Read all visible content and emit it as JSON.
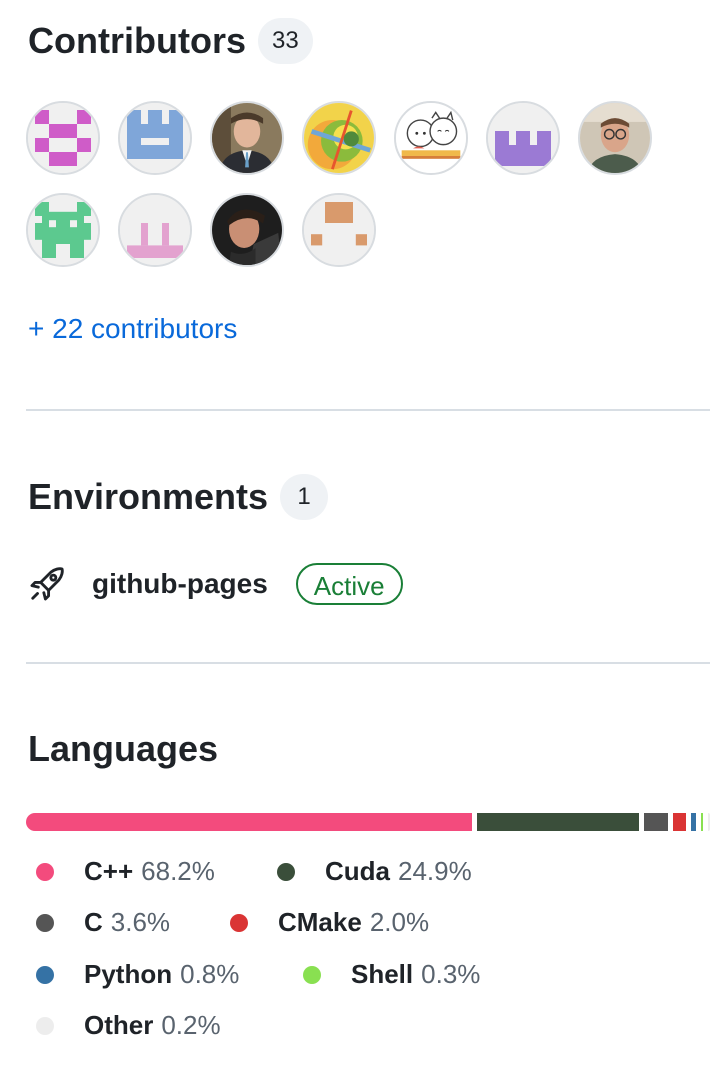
{
  "contributors": {
    "title": "Contributors",
    "count": "33",
    "more_link": "+ 22 contributors",
    "avatars": [
      {
        "name": "avatar-pink-identicon"
      },
      {
        "name": "avatar-blue-identicon"
      },
      {
        "name": "avatar-photo-man-suit"
      },
      {
        "name": "avatar-colorful-abstract"
      },
      {
        "name": "avatar-cartoon-animals"
      },
      {
        "name": "avatar-purple-identicon"
      },
      {
        "name": "avatar-photo-man-glasses"
      },
      {
        "name": "avatar-green-identicon"
      },
      {
        "name": "avatar-pink-light-identicon"
      },
      {
        "name": "avatar-photo-man-dark"
      },
      {
        "name": "avatar-orange-identicon"
      }
    ]
  },
  "environments": {
    "title": "Environments",
    "count": "1",
    "items": [
      {
        "name": "github-pages",
        "status": "Active",
        "icon": "rocket-icon"
      }
    ]
  },
  "languages": {
    "title": "Languages",
    "items": [
      {
        "name": "C++",
        "percent": "68.2%",
        "value": 68.2,
        "color": "#f34b7d"
      },
      {
        "name": "Cuda",
        "percent": "24.9%",
        "value": 24.9,
        "color": "#3a4e3a"
      },
      {
        "name": "C",
        "percent": "3.6%",
        "value": 3.6,
        "color": "#555555"
      },
      {
        "name": "CMake",
        "percent": "2.0%",
        "value": 2.0,
        "color": "#da3434"
      },
      {
        "name": "Python",
        "percent": "0.8%",
        "value": 0.8,
        "color": "#3572a5"
      },
      {
        "name": "Shell",
        "percent": "0.3%",
        "value": 0.3,
        "color": "#89e051"
      },
      {
        "name": "Other",
        "percent": "0.2%",
        "value": 0.2,
        "color": "#ededed"
      }
    ]
  }
}
